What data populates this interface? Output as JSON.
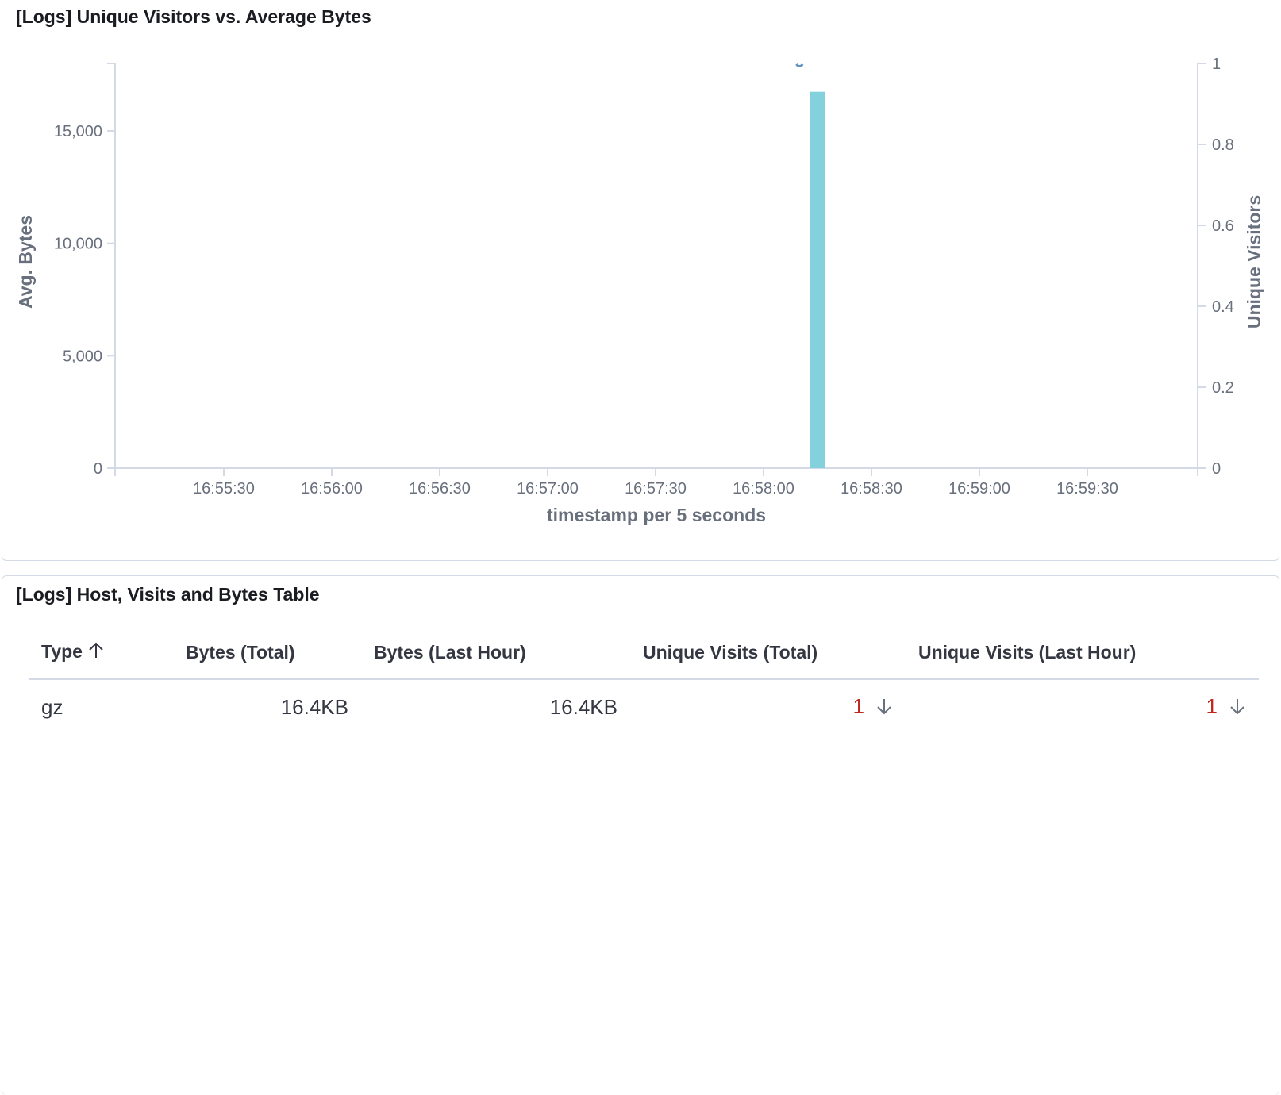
{
  "chart_panel": {
    "title": "[Logs] Unique Visitors vs. Average Bytes"
  },
  "chart_data": {
    "type": "bar",
    "x_ticks": [
      "16:55:30",
      "16:56:00",
      "16:56:30",
      "16:57:00",
      "16:57:30",
      "16:58:00",
      "16:58:30",
      "16:59:00",
      "16:59:30"
    ],
    "xlabel": "timestamp per 5 seconds",
    "ylabel_left": "Avg. Bytes",
    "ylabel_right": "Unique Visitors",
    "y_left_ticks": [
      "0",
      "5,000",
      "10,000",
      "15,000"
    ],
    "y_right_ticks": [
      "0",
      "0.2",
      "0.4",
      "0.6",
      "0.8",
      "1"
    ],
    "ylim_left": [
      0,
      18000
    ],
    "ylim_right": [
      0,
      1
    ],
    "series": [
      {
        "type": "bar",
        "axis": "left",
        "color": "#82d1dd",
        "points": [
          {
            "x": "16:58:15",
            "y": 16740
          }
        ]
      },
      {
        "type": "line",
        "axis": "right",
        "color": "#6092c0",
        "points": [
          {
            "x": "16:58:10",
            "y": 1
          }
        ]
      }
    ],
    "grid": false
  },
  "table_panel": {
    "title": "[Logs] Host, Visits and Bytes Table",
    "columns": [
      "Type",
      "Bytes (Total)",
      "Bytes (Last Hour)",
      "Unique Visits (Total)",
      "Unique Visits (Last Hour)"
    ],
    "sort_icon": "arrow-up-icon",
    "rows": [
      {
        "type": "gz",
        "bytes_total": "16.4KB",
        "bytes_last_hour": "16.4KB",
        "visits_total": "1",
        "visits_last_hour": "1",
        "trend_icon": "arrow-down-icon"
      }
    ],
    "accent_red": "#bd271e"
  }
}
